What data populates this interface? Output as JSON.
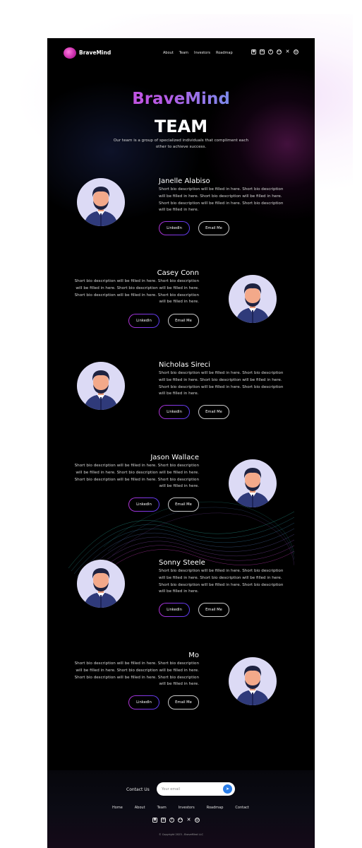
{
  "brand": {
    "name": "BraveMind"
  },
  "nav": {
    "links": [
      "About",
      "Team",
      "Investors",
      "Roadmap"
    ],
    "social_icons": [
      "discord-icon",
      "linkedin-icon",
      "facebook-icon",
      "medium-icon",
      "x-icon",
      "instagram-icon"
    ]
  },
  "hero": {
    "brand_title": "BraveMind",
    "title": "TEAM",
    "subtitle": "Our team is a group of specialized individuals that compliment each other to achieve success."
  },
  "members": [
    {
      "name": "Janelle Alabiso",
      "bio": "Short bio description will be filled in here. Short bio description will be filled in here. Short bio description will be filled in here. Short bio description will be filled in here. Short bio description will be filled in here.",
      "linkedin_label": "LinkedIn",
      "email_label": "Email Me"
    },
    {
      "name": "Casey Conn",
      "bio": "Short bio description will be filled in here. Short bio description will be filled in here. Short bio description will be filled in here. Short bio description will be filled in here. Short bio description will be filled in here.",
      "linkedin_label": "LinkedIn",
      "email_label": "Email Me"
    },
    {
      "name": "Nicholas Sireci",
      "bio": "Short bio description will be filled in here. Short bio description will be filled in here. Short bio description will be filled in here. Short bio description will be filled in here. Short bio description will be filled in here.",
      "linkedin_label": "LinkedIn",
      "email_label": "Email Me"
    },
    {
      "name": "Jason Wallace",
      "bio": "Short bio description will be filled in here. Short bio description will be filled in here. Short bio description will be filled in here. Short bio description will be filled in here. Short bio description will be filled in here.",
      "linkedin_label": "LinkedIn",
      "email_label": "Email Me"
    },
    {
      "name": "Sonny Steele",
      "bio": "Short bio description will be filled in here. Short bio description will be filled in here. Short bio description will be filled in here. Short bio description will be filled in here. Short bio description will be filled in here.",
      "linkedin_label": "LinkedIn",
      "email_label": "Email Me"
    },
    {
      "name": "Mo",
      "bio": "Short bio description will be filled in here. Short bio description will be filled in here. Short bio description will be filled in here. Short bio description will be filled in here. Short bio description will be filled in here.",
      "linkedin_label": "LinkedIn",
      "email_label": "Email Me"
    }
  ],
  "footer": {
    "contact_label": "Contact Us",
    "email_placeholder": "Your email",
    "links": [
      "Home",
      "About",
      "Team",
      "Investors",
      "Roadmap",
      "Contact"
    ],
    "copyright": "© Copyright 2023 - BraveMind LLC"
  },
  "colors": {
    "background": "#000000",
    "brand_gradient_start": "#e23fd8",
    "brand_gradient_end": "#2fc9f2",
    "avatar_bg": "#dcdaf5",
    "send_button": "#2a7de8"
  }
}
